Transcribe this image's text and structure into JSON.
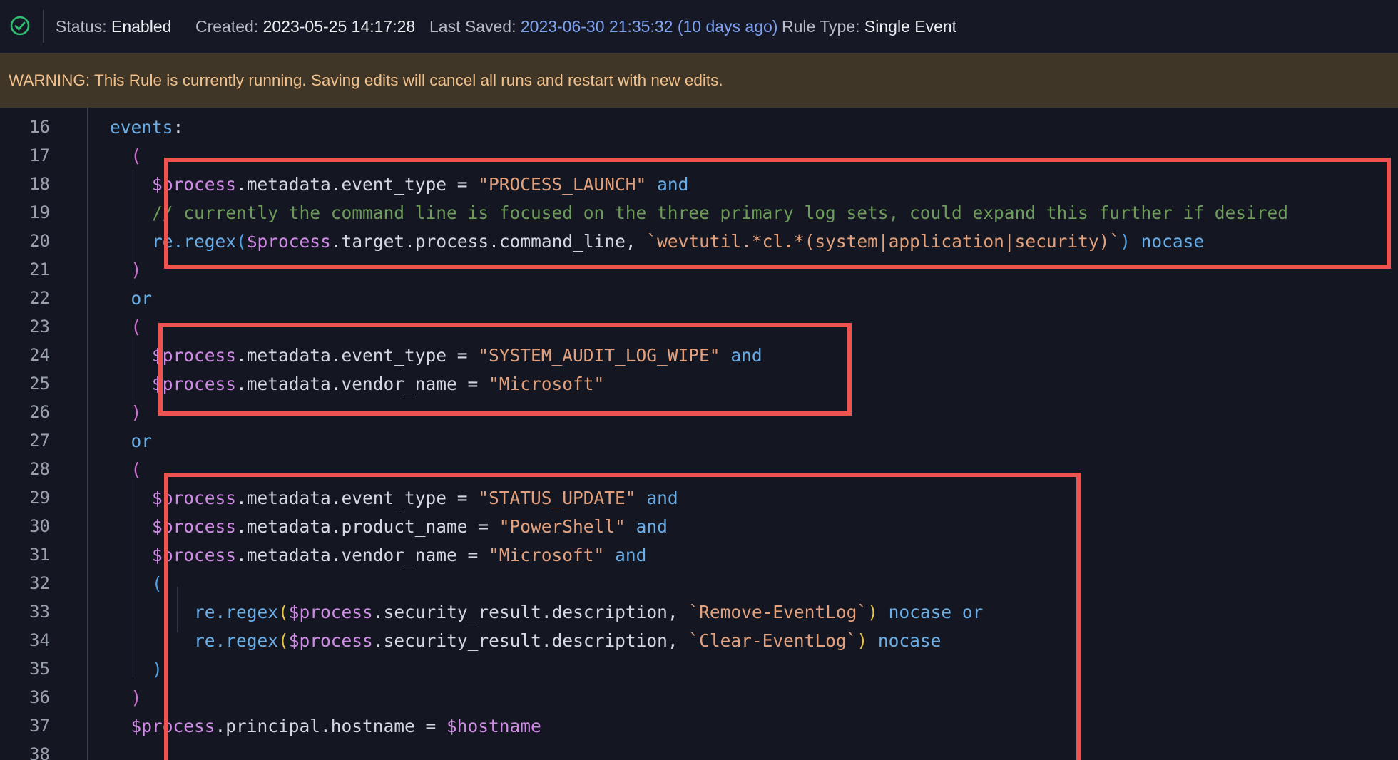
{
  "status_bar": {
    "status_label": "Status:",
    "status_value": "Enabled",
    "created_label": "Created:",
    "created_value": "2023-05-25 14:17:28",
    "saved_label": "Last Saved:",
    "saved_value": "2023-06-30 21:35:32 (10 days ago)",
    "rule_type_label": "Rule Type:",
    "rule_type_value": "Single Event",
    "status_icon": "check-circle-icon",
    "status_color": "#2fbf71"
  },
  "warning": {
    "text": "WARNING: This Rule is currently running. Saving edits will cancel all runs and restart with new edits."
  },
  "editor": {
    "line_numbers": [
      "16",
      "17",
      "18",
      "19",
      "20",
      "21",
      "22",
      "23",
      "24",
      "25",
      "26",
      "27",
      "28",
      "29",
      "30",
      "31",
      "32",
      "33",
      "34",
      "35",
      "36",
      "37",
      "38"
    ],
    "lines": [
      [
        [
          "t-kw",
          "events"
        ],
        [
          "t-plain",
          ":"
        ]
      ],
      [
        [
          "t-plain",
          "  "
        ],
        [
          "t-p1",
          "("
        ]
      ],
      [
        [
          "t-plain",
          "    "
        ],
        [
          "t-var",
          "$process"
        ],
        [
          "t-plain",
          ".metadata.event_type = "
        ],
        [
          "t-str",
          "\"PROCESS_LAUNCH\""
        ],
        [
          "t-plain",
          " "
        ],
        [
          "t-kw",
          "and"
        ]
      ],
      [
        [
          "t-plain",
          "    "
        ],
        [
          "t-cmt",
          "// currently the command line is focused on the three primary log sets, could expand this further if desired"
        ]
      ],
      [
        [
          "t-plain",
          "    "
        ],
        [
          "t-fn",
          "re.regex"
        ],
        [
          "t-p3",
          "("
        ],
        [
          "t-var",
          "$process"
        ],
        [
          "t-plain",
          ".target.process.command_line, "
        ],
        [
          "t-str",
          "`wevtutil.*cl.*(system|application|security)`"
        ],
        [
          "t-p3",
          ")"
        ],
        [
          "t-plain",
          " "
        ],
        [
          "t-kw",
          "nocase"
        ]
      ],
      [
        [
          "t-plain",
          "  "
        ],
        [
          "t-p1",
          ")"
        ]
      ],
      [
        [
          "t-plain",
          "  "
        ],
        [
          "t-kw",
          "or"
        ]
      ],
      [
        [
          "t-plain",
          "  "
        ],
        [
          "t-p1",
          "("
        ]
      ],
      [
        [
          "t-plain",
          "    "
        ],
        [
          "t-var",
          "$process"
        ],
        [
          "t-plain",
          ".metadata.event_type = "
        ],
        [
          "t-str",
          "\"SYSTEM_AUDIT_LOG_WIPE\""
        ],
        [
          "t-plain",
          " "
        ],
        [
          "t-kw",
          "and"
        ]
      ],
      [
        [
          "t-plain",
          "    "
        ],
        [
          "t-var",
          "$process"
        ],
        [
          "t-plain",
          ".metadata.vendor_name = "
        ],
        [
          "t-str",
          "\"Microsoft\""
        ]
      ],
      [
        [
          "t-plain",
          "  "
        ],
        [
          "t-p1",
          ")"
        ]
      ],
      [
        [
          "t-plain",
          "  "
        ],
        [
          "t-kw",
          "or"
        ]
      ],
      [
        [
          "t-plain",
          "  "
        ],
        [
          "t-p1",
          "("
        ]
      ],
      [
        [
          "t-plain",
          "    "
        ],
        [
          "t-var",
          "$process"
        ],
        [
          "t-plain",
          ".metadata.event_type = "
        ],
        [
          "t-str",
          "\"STATUS_UPDATE\""
        ],
        [
          "t-plain",
          " "
        ],
        [
          "t-kw",
          "and"
        ]
      ],
      [
        [
          "t-plain",
          "    "
        ],
        [
          "t-var",
          "$process"
        ],
        [
          "t-plain",
          ".metadata.product_name = "
        ],
        [
          "t-str",
          "\"PowerShell\""
        ],
        [
          "t-plain",
          " "
        ],
        [
          "t-kw",
          "and"
        ]
      ],
      [
        [
          "t-plain",
          "    "
        ],
        [
          "t-var",
          "$process"
        ],
        [
          "t-plain",
          ".metadata.vendor_name = "
        ],
        [
          "t-str",
          "\"Microsoft\""
        ],
        [
          "t-plain",
          " "
        ],
        [
          "t-kw",
          "and"
        ]
      ],
      [
        [
          "t-plain",
          "    "
        ],
        [
          "t-p3",
          "("
        ]
      ],
      [
        [
          "t-plain",
          "        "
        ],
        [
          "t-fn",
          "re.regex"
        ],
        [
          "t-p2",
          "("
        ],
        [
          "t-var",
          "$process"
        ],
        [
          "t-plain",
          ".security_result.description, "
        ],
        [
          "t-str",
          "`Remove-EventLog`"
        ],
        [
          "t-p2",
          ")"
        ],
        [
          "t-plain",
          " "
        ],
        [
          "t-kw",
          "nocase or"
        ]
      ],
      [
        [
          "t-plain",
          "        "
        ],
        [
          "t-fn",
          "re.regex"
        ],
        [
          "t-p2",
          "("
        ],
        [
          "t-var",
          "$process"
        ],
        [
          "t-plain",
          ".security_result.description, "
        ],
        [
          "t-str",
          "`Clear-EventLog`"
        ],
        [
          "t-p2",
          ")"
        ],
        [
          "t-plain",
          " "
        ],
        [
          "t-kw",
          "nocase"
        ]
      ],
      [
        [
          "t-plain",
          "    "
        ],
        [
          "t-p3",
          ")"
        ]
      ],
      [
        [
          "t-plain",
          "  "
        ],
        [
          "t-p1",
          ")"
        ]
      ],
      [
        [
          "t-plain",
          "  "
        ],
        [
          "t-var",
          "$process"
        ],
        [
          "t-plain",
          ".principal.hostname = "
        ],
        [
          "t-var",
          "$hostname"
        ]
      ],
      [
        [
          "t-plain",
          ""
        ]
      ]
    ],
    "highlight_color": "#ef5350"
  }
}
